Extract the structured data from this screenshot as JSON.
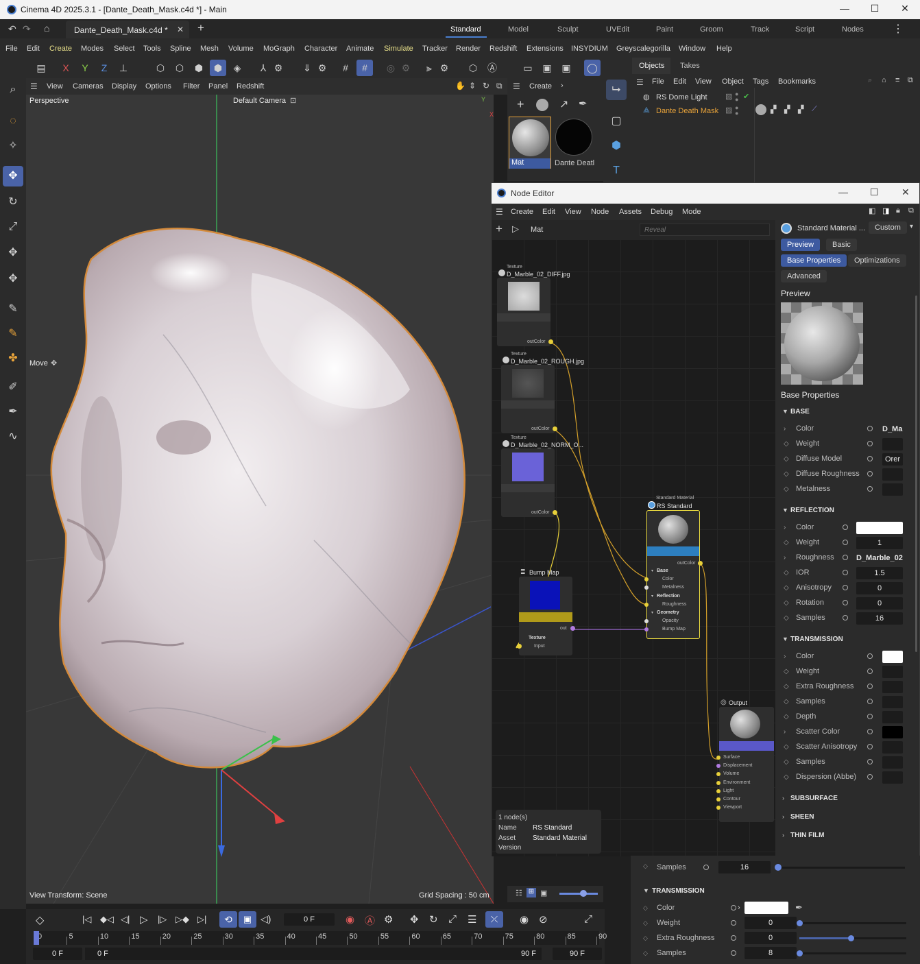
{
  "window": {
    "title": "Cinema 4D 2025.3.1 - [Dante_Death_Mask.c4d *] - Main",
    "min": "—",
    "max": "☐",
    "close": "✕"
  },
  "doc_tab": {
    "label": "Dante_Death_Mask.c4d *",
    "close": "✕",
    "add": "+"
  },
  "layouts": [
    "Standard",
    "Model",
    "Sculpt",
    "UVEdit",
    "Paint",
    "Groom",
    "Track",
    "Script",
    "Nodes"
  ],
  "menu": [
    "File",
    "Edit",
    "Create",
    "Modes",
    "Select",
    "Tools",
    "Spline",
    "Mesh",
    "Volume",
    "MoGraph",
    "Character",
    "Animate",
    "Simulate",
    "Tracker",
    "Render",
    "Redshift",
    "Extensions",
    "INSYDIUM",
    "Greyscalegorilla",
    "Window",
    "Help"
  ],
  "toolbar": {
    "x": "X",
    "y": "Y",
    "z": "Z"
  },
  "viewport": {
    "menu": [
      "View",
      "Cameras",
      "Display",
      "Options",
      "Filter",
      "Panel",
      "Redshift"
    ],
    "name": "Perspective",
    "camera": "Default Camera",
    "tool": "Move",
    "view_transform": "View Transform: Scene",
    "grid_spacing": "Grid Spacing : 50 cm"
  },
  "materials": {
    "create": "Create",
    "items": [
      "Mat",
      "Dante Deatl"
    ]
  },
  "objects": {
    "tabs": [
      "Objects",
      "Takes"
    ],
    "menu": [
      "File",
      "Edit",
      "View",
      "Object",
      "Tags",
      "Bookmarks"
    ],
    "items": [
      "RS Dome Light",
      "Dante Death Mask"
    ]
  },
  "node_editor": {
    "title": "Node Editor",
    "menu": [
      "Create",
      "Edit",
      "View",
      "Node",
      "Assets",
      "Debug",
      "Mode"
    ],
    "breadcrumb": "Mat",
    "search_placeholder": "Reveal",
    "nodes": {
      "tex1": {
        "type": "Texture",
        "name": "D_Marble_02_DIFF.jpg",
        "port": "outColor"
      },
      "tex2": {
        "type": "Texture",
        "name": "D_Marble_02_ROUGH.jpg",
        "port": "outColor"
      },
      "tex3": {
        "type": "Texture",
        "name": "D_Marble_02_NORM_O...",
        "port": "outColor"
      },
      "bump": {
        "name": "Bump Map",
        "out": "out",
        "group": "Texture",
        "input": "Input"
      },
      "std": {
        "type": "Standard Material",
        "name": "RS Standard",
        "out": "outColor",
        "rows": [
          "Base",
          "Color",
          "Metalness",
          "Reflection",
          "Roughness",
          "Geometry",
          "Opacity",
          "Bump Map"
        ]
      },
      "output": {
        "name": "Output",
        "ports": [
          "Surface",
          "Displacement",
          "Volume",
          "Environment",
          "Light",
          "Contour",
          "Viewport"
        ]
      }
    },
    "info": {
      "count": "1 node(s)",
      "name_label": "Name",
      "name": "RS Standard",
      "asset_label": "Asset",
      "asset": "Standard Material",
      "version_label": "Version"
    },
    "attr": {
      "header": "Standard Material ...",
      "preset": "Custom",
      "tabs1": [
        "Preview",
        "Basic"
      ],
      "tabs2": [
        "Base Properties",
        "Optimizations"
      ],
      "tabs3": [
        "Advanced"
      ],
      "preview_title": "Preview",
      "base_title": "Base Properties",
      "base": {
        "title": "BASE",
        "rows": [
          [
            "Color",
            "D_Ma"
          ],
          [
            "Weight",
            ""
          ],
          [
            "Diffuse Model",
            "Orer"
          ],
          [
            "Diffuse Roughness",
            ""
          ],
          [
            "Metalness",
            ""
          ]
        ]
      },
      "reflection": {
        "title": "REFLECTION",
        "rows": [
          [
            "Color",
            ""
          ],
          [
            "Weight",
            "1"
          ],
          [
            "Roughness",
            "D_Marble_02"
          ],
          [
            "IOR",
            "1.5"
          ],
          [
            "Anisotropy",
            "0"
          ],
          [
            "Rotation",
            "0"
          ],
          [
            "Samples",
            "16"
          ]
        ]
      },
      "transmission": {
        "title": "TRANSMISSION",
        "rows": [
          [
            "Color",
            ""
          ],
          [
            "Weight",
            ""
          ],
          [
            "Extra Roughness",
            ""
          ],
          [
            "Samples",
            ""
          ],
          [
            "Depth",
            ""
          ],
          [
            "Scatter Color",
            ""
          ],
          [
            "Scatter Anisotropy",
            ""
          ],
          [
            "Samples",
            ""
          ],
          [
            "Dispersion (Abbe)",
            ""
          ]
        ]
      },
      "collapsed": [
        "SUBSURFACE",
        "SHEEN",
        "THIN FILM"
      ]
    }
  },
  "attr_bottom": {
    "samples_label": "Samples",
    "samples": "16",
    "section": "TRANSMISSION",
    "rows": [
      [
        "Color",
        ""
      ],
      [
        "Weight",
        "0"
      ],
      [
        "Extra Roughness",
        "0"
      ],
      [
        "Samples",
        "8"
      ]
    ],
    "slider_fill": [
      0,
      0.48,
      0
    ]
  },
  "timeline": {
    "ticks": [
      "0",
      "5",
      "10",
      "15",
      "20",
      "25",
      "30",
      "35",
      "40",
      "45",
      "50",
      "55",
      "60",
      "65",
      "70",
      "75",
      "80",
      "85",
      "90"
    ],
    "frame": "0 F",
    "start": "0 F",
    "start2": "0 F",
    "end": "90 F",
    "end2": "90 F"
  }
}
